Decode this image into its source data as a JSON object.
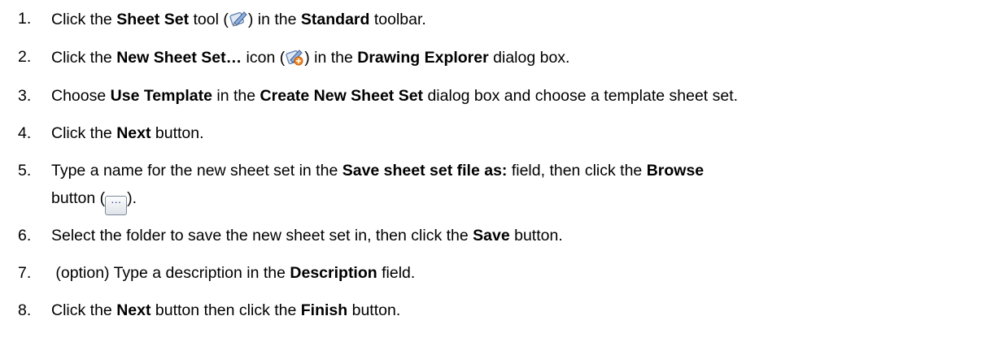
{
  "steps": [
    {
      "num": "1.",
      "parts": [
        "Click the ",
        "Sheet Set",
        " tool (",
        ") in the ",
        "Standard",
        " toolbar."
      ],
      "icon": "sheet-set-icon"
    },
    {
      "num": "2.",
      "parts": [
        "Click the ",
        "New Sheet Set…",
        " icon (",
        ") in the ",
        "Drawing Explorer",
        " dialog box."
      ],
      "icon": "new-sheet-set-icon"
    },
    {
      "num": "3.",
      "parts": [
        "Choose ",
        "Use Template",
        " in the ",
        "Create New Sheet Set",
        " dialog box and choose a template sheet set."
      ]
    },
    {
      "num": "4.",
      "parts": [
        "Click the ",
        "Next",
        " button."
      ]
    },
    {
      "num": "5.",
      "parts": [
        "Type a name for the new sheet set in the ",
        "Save sheet set file as:",
        " field, then click the ",
        "Browse"
      ],
      "cont": [
        "button (",
        ")."
      ],
      "button_glyph": "···",
      "icon": "browse-button"
    },
    {
      "num": "6.",
      "parts": [
        "Select the folder to save the new sheet set in, then click the ",
        "Save",
        " button."
      ]
    },
    {
      "num": "7.",
      "parts": [
        " (option) Type a description in the ",
        "Description",
        " field."
      ]
    },
    {
      "num": "8.",
      "parts": [
        "Click the ",
        "Next",
        " button then click the ",
        "Finish",
        " button."
      ]
    }
  ]
}
